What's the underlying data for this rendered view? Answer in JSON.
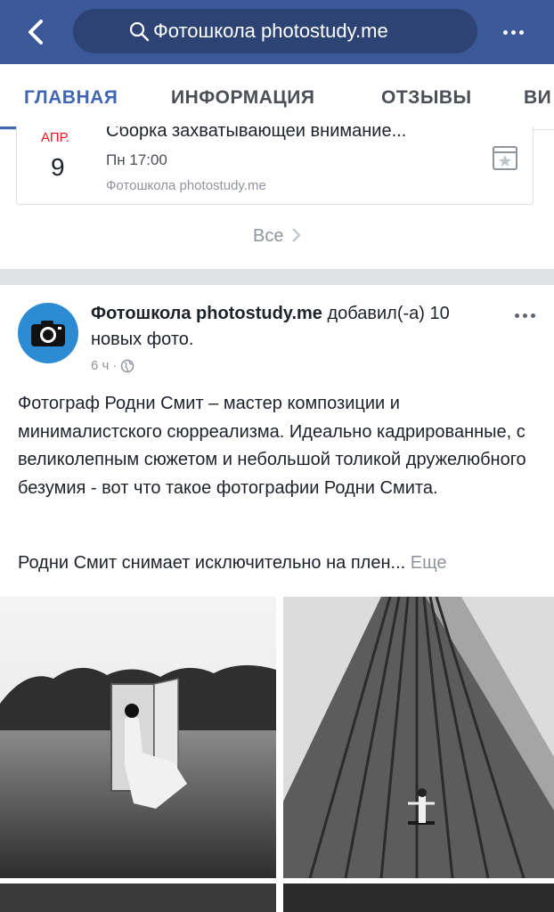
{
  "header": {
    "search_text": "Фотошкола photostudy.me",
    "bg_color": "#3b5998"
  },
  "tabs": [
    {
      "label": "ГЛАВНАЯ",
      "active": true
    },
    {
      "label": "ИНФОРМАЦИЯ",
      "active": false
    },
    {
      "label": "ОТЗЫВЫ",
      "active": false
    },
    {
      "label": "ВИ",
      "active": false
    }
  ],
  "event": {
    "month": "АПР.",
    "day": "9",
    "title": "Сборка захватывающей внимание...",
    "time": "Пн 17:00",
    "organizer": "Фотошкола photostudy.me"
  },
  "events_see_all": "Все",
  "post": {
    "author": "Фотошкола photostudy.me",
    "action": "добавил(-а) 10 новых фото.",
    "time": "6 ч",
    "paragraph_1": "Фотограф Родни Смит – мастер композиции и минималистского сюрреализма. Идеально кадрированные, с великолепным сюжетом и небольшой толикой дружелюбного безумия - вот что такое фотографии Родни Смита.",
    "paragraph_2": "Родни Смит снимает исключительно на плен...",
    "more_label": "Еще"
  },
  "icons": [
    "back-icon",
    "search-icon",
    "more-icon",
    "calendar-star-icon",
    "chevron-right-icon",
    "camera-icon",
    "globe-icon"
  ]
}
